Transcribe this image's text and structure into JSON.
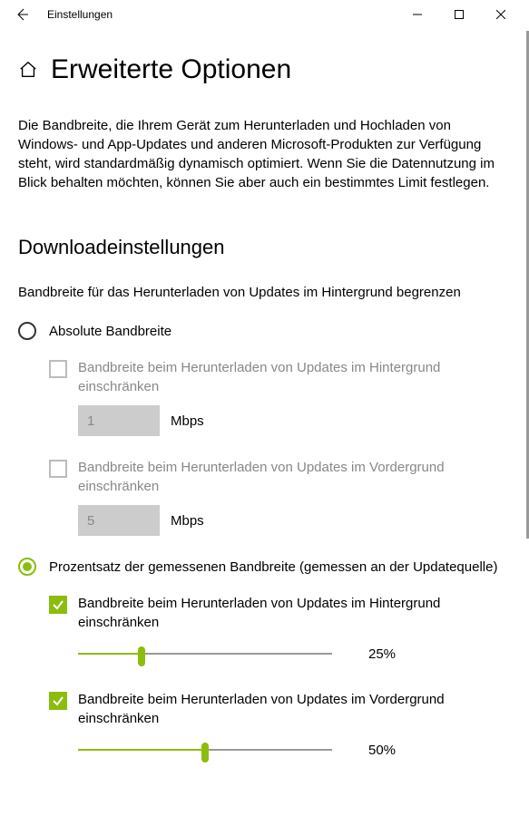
{
  "window": {
    "title": "Einstellungen"
  },
  "page": {
    "title": "Erweiterte Optionen",
    "intro": "Die Bandbreite, die Ihrem Gerät zum Herunterladen und Hochladen von Windows- und App-Updates und anderen Microsoft-Produkten zur Verfügung steht, wird standardmäßig dynamisch optimiert. Wenn Sie die Datennutzung im Blick behalten möchten, können Sie aber auch ein bestimmtes Limit festlegen."
  },
  "download": {
    "sectionTitle": "Downloadeinstellungen",
    "subheading": "Bandbreite für das Herunterladen von Updates im Hintergrund begrenzen",
    "radioAbsolute": "Absolute Bandbreite",
    "radioPercent": "Prozentsatz der gemessenen Bandbreite (gemessen an der Updatequelle)",
    "bgLimitLabel": "Bandbreite beim Herunterladen von Updates im Hintergrund einschränken",
    "fgLimitLabel": "Bandbreite beim Herunterladen von Updates im Vordergrund einschränken",
    "mbps": "Mbps",
    "abs": {
      "bgValue": "1",
      "fgValue": "5"
    },
    "pct": {
      "bgValue": "25%",
      "bgPercent": 25,
      "fgValue": "50%",
      "fgPercent": 50
    }
  }
}
